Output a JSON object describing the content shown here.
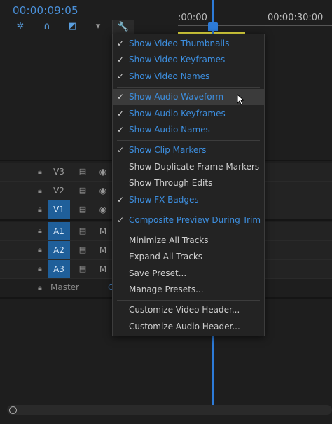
{
  "timecode": "00:00:09:05",
  "toolbar": {
    "icons": [
      "snap-icon",
      "magnet-icon",
      "linked-selection-icon",
      "add-marker-icon",
      "wrench-icon"
    ]
  },
  "ruler": {
    "labels": [
      ":00:00",
      "00:00:30:00"
    ]
  },
  "tracks": {
    "video": [
      {
        "name": "V3",
        "active": false
      },
      {
        "name": "V2",
        "active": false
      },
      {
        "name": "V1",
        "active": true
      }
    ],
    "audio": [
      {
        "name": "A1",
        "active": true,
        "mute": "M"
      },
      {
        "name": "A2",
        "active": true,
        "mute": "M"
      },
      {
        "name": "A3",
        "active": true,
        "mute": "M"
      }
    ],
    "master": {
      "name": "Master",
      "value_prefix": "C"
    }
  },
  "menu": {
    "items": [
      {
        "label": "Show Video Thumbnails",
        "checked": true
      },
      {
        "label": "Show Video Keyframes",
        "checked": true
      },
      {
        "label": "Show Video Names",
        "checked": true
      },
      {
        "label": "Show Audio Waveform",
        "checked": true,
        "hover": true
      },
      {
        "label": "Show Audio Keyframes",
        "checked": true
      },
      {
        "label": "Show Audio Names",
        "checked": true
      },
      {
        "label": "Show Clip Markers",
        "checked": true
      },
      {
        "label": "Show Duplicate Frame Markers",
        "checked": false
      },
      {
        "label": "Show Through Edits",
        "checked": false
      },
      {
        "label": "Show FX Badges",
        "checked": true
      },
      {
        "label": "Composite Preview During Trim",
        "checked": true
      },
      {
        "label": "Minimize All Tracks",
        "checked": false
      },
      {
        "label": "Expand All Tracks",
        "checked": false
      },
      {
        "label": "Save Preset...",
        "checked": false
      },
      {
        "label": "Manage Presets...",
        "checked": false
      },
      {
        "label": "Customize Video Header...",
        "checked": false
      },
      {
        "label": "Customize Audio Header...",
        "checked": false
      }
    ]
  },
  "colors": {
    "accent": "#3d8fe0",
    "work_area": "#e8e040",
    "track_active": "#1f5f9a"
  }
}
